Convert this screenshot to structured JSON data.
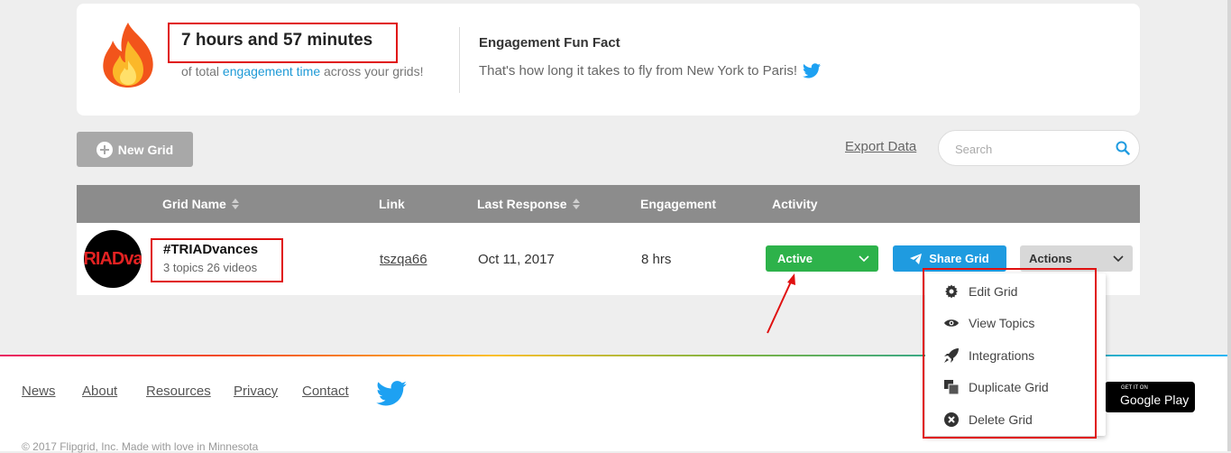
{
  "stats": {
    "engagement_time": "7 hours and 57 minutes",
    "sub_prefix": "of total ",
    "sub_highlight": "engagement time",
    "sub_suffix": " across your grids!",
    "fact_title": "Engagement Fun Fact",
    "fact_text": "That's how long it takes to fly from New York to Paris!"
  },
  "toolbar": {
    "new_grid_label": "New Grid",
    "export_label": "Export Data",
    "search_placeholder": "Search"
  },
  "table": {
    "headers": {
      "grid_name": "Grid Name",
      "link": "Link",
      "last_response": "Last Response",
      "engagement": "Engagement",
      "activity": "Activity"
    },
    "rows": [
      {
        "avatar_text": "RIADva",
        "title": "#TRIADvances",
        "subtitle": "3 topics 26 videos",
        "link": "tszqa66",
        "last_response": "Oct 11, 2017",
        "engagement": "8 hrs",
        "activity": "Active",
        "share_label": "Share Grid",
        "actions_label": "Actions"
      }
    ]
  },
  "actions_menu": [
    {
      "label": "Edit Grid",
      "icon": "gear-icon"
    },
    {
      "label": "View Topics",
      "icon": "eye-icon"
    },
    {
      "label": "Integrations",
      "icon": "rocket-icon"
    },
    {
      "label": "Duplicate Grid",
      "icon": "duplicate-icon"
    },
    {
      "label": "Delete Grid",
      "icon": "close-circle-icon"
    }
  ],
  "footer": {
    "links": [
      "News",
      "About",
      "Resources",
      "Privacy",
      "Contact"
    ],
    "google_play_small": "GET IT ON",
    "google_play_big": "Google Play",
    "copyright": "© 2017 Flipgrid, Inc. Made with love in Minnesota"
  },
  "colors": {
    "active_green": "#2db24a",
    "share_blue": "#1f9be0",
    "annotation_red": "#e01010",
    "header_gray": "#8c8c8c"
  }
}
